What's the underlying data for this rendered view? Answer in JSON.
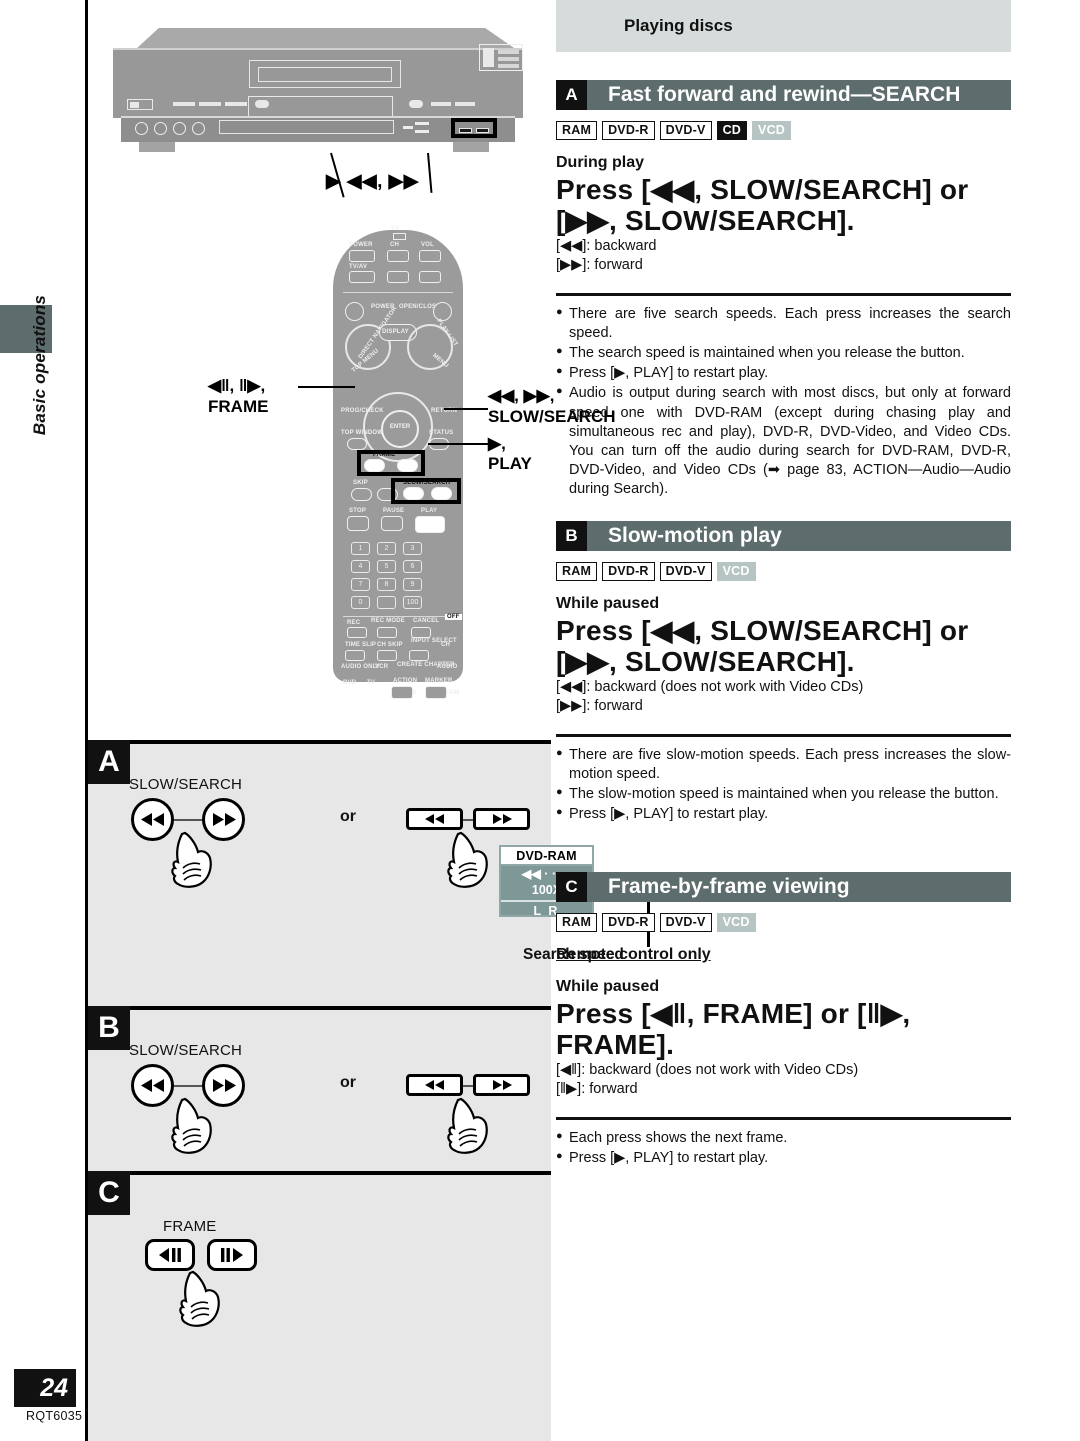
{
  "rail": {
    "section_label": "Basic operations",
    "page_number": "24",
    "doc_code": "RQT6035"
  },
  "left_column": {
    "deck_callout": "▶   ◀◀, ▶▶",
    "remote_callouts": {
      "frame": "◀‖, ‖▶,\nFRAME",
      "frame_line1": "◀‖, ‖▶,",
      "frame_line2": "FRAME",
      "slow_search_line1": "◀◀, ▶▶,",
      "slow_search_line2": "SLOW/SEARCH",
      "play": "▶, PLAY"
    },
    "remote_labels": {
      "tv": "TV",
      "power_tv": "POWER",
      "ch": "CH",
      "vol": "VOL",
      "tv_av": "TV/AV",
      "power": "POWER",
      "open_close": "OPEN/CLOSE",
      "direct_navigator": "DIRECT NAVIGATOR",
      "display": "DISPLAY",
      "play_list": "PLAY LIST",
      "top_menu": "TOP MENU",
      "menu": "MENU",
      "prog_check": "PROG/CHECK",
      "return": "RETURN",
      "top_window": "TOP WINDOW",
      "status": "STATUS",
      "enter": "ENTER",
      "frame": "FRAME",
      "skip": "SKIP",
      "slow_search": "SLOW/SEARCH",
      "stop": "STOP",
      "pause": "PAUSE",
      "play": "PLAY",
      "rec": "REC",
      "rec_mode": "REC MODE",
      "cancel": "CANCEL",
      "off": "OFF",
      "time_slip": "TIME SLIP",
      "ch_skip": "CH SKIP",
      "input_select": "INPUT SELECT",
      "ch_up": "CH",
      "audio_only": "AUDIO ONLY",
      "vcr": "VCR",
      "create_chapter": "CREATE CHAPTER",
      "audio": "AUDIO",
      "dvd": "DVD",
      "tv_btn": "TV",
      "action": "ACTION",
      "marker": "MARKER",
      "erase": "ERASE",
      "maintain": "MAINTAIN"
    },
    "sections": [
      {
        "letter": "A",
        "control_label": "SLOW/SEARCH",
        "or_label": "or",
        "osd": {
          "title": "DVD-RAM",
          "indicator": "◀◀ · · · ·",
          "speed": "100X",
          "channels": "L R",
          "caption": "Search speed"
        }
      },
      {
        "letter": "B",
        "control_label": "SLOW/SEARCH",
        "or_label": "or"
      },
      {
        "letter": "C",
        "control_label": "FRAME"
      }
    ]
  },
  "right_column": {
    "chapter_title": "Playing discs",
    "sections": [
      {
        "letter": "A",
        "title": "Fast forward and rewind—SEARCH",
        "badges": [
          {
            "label": "RAM",
            "style": "out"
          },
          {
            "label": "DVD-R",
            "style": "out"
          },
          {
            "label": "DVD-V",
            "style": "out"
          },
          {
            "label": "CD",
            "style": "solid"
          },
          {
            "label": "VCD",
            "style": "dim"
          }
        ],
        "condition": "During play",
        "instruction": "Press  [◀◀,  SLOW/SEARCH]  or  [▶▶, SLOW/SEARCH].",
        "key_lines": [
          "[◀◀]:  backward",
          "[▶▶]:  forward"
        ],
        "notes": [
          "There are five search speeds. Each press increases the search speed.",
          "The search speed is maintained when you release the button.",
          "Press [▶, PLAY] to restart play.",
          "Audio is output during search with most discs, but only at forward speed one with DVD-RAM (except during chasing play and simultaneous rec and play), DVD-R, DVD-Video, and Video CDs. You can turn off the audio during search for DVD-RAM, DVD-R, DVD-Video, and Video CDs (➡ page 83, ACTION—Audio—Audio during Search)."
        ]
      },
      {
        "letter": "B",
        "title": "Slow-motion play",
        "badges": [
          {
            "label": "RAM",
            "style": "out"
          },
          {
            "label": "DVD-R",
            "style": "out"
          },
          {
            "label": "DVD-V",
            "style": "out"
          },
          {
            "label": "VCD",
            "style": "dim"
          }
        ],
        "condition": "While paused",
        "instruction": "Press  [◀◀,  SLOW/SEARCH]  or  [▶▶, SLOW/SEARCH].",
        "key_lines": [
          "[◀◀]:  backward (does not work with Video CDs)",
          "[▶▶]:  forward"
        ],
        "notes": [
          "There are five slow-motion speeds. Each press increases the slow-motion speed.",
          "The slow-motion speed is maintained when you release the button.",
          "Press [▶, PLAY] to restart play."
        ]
      },
      {
        "letter": "C",
        "title": "Frame-by-frame viewing",
        "badges": [
          {
            "label": "RAM",
            "style": "out"
          },
          {
            "label": "DVD-R",
            "style": "out"
          },
          {
            "label": "DVD-V",
            "style": "out"
          },
          {
            "label": "VCD",
            "style": "dim"
          }
        ],
        "remote_only": "Remote control only",
        "condition": "While paused",
        "instruction": "Press [◀‖, FRAME] or [‖▶, FRAME].",
        "key_lines": [
          "[◀‖]:  backward (does not work with Video CDs)",
          "[‖▶]:  forward"
        ],
        "notes": [
          "Each press shows the next frame.",
          "Press [▶, PLAY] to restart play."
        ]
      }
    ]
  },
  "colors": {
    "header_band": "#d6dcdc",
    "section_bar": "#5d6c6c",
    "panel_bg": "#e7e7e7",
    "badge_dim": "#b6c4c4",
    "osd_body": "#7e9797"
  }
}
